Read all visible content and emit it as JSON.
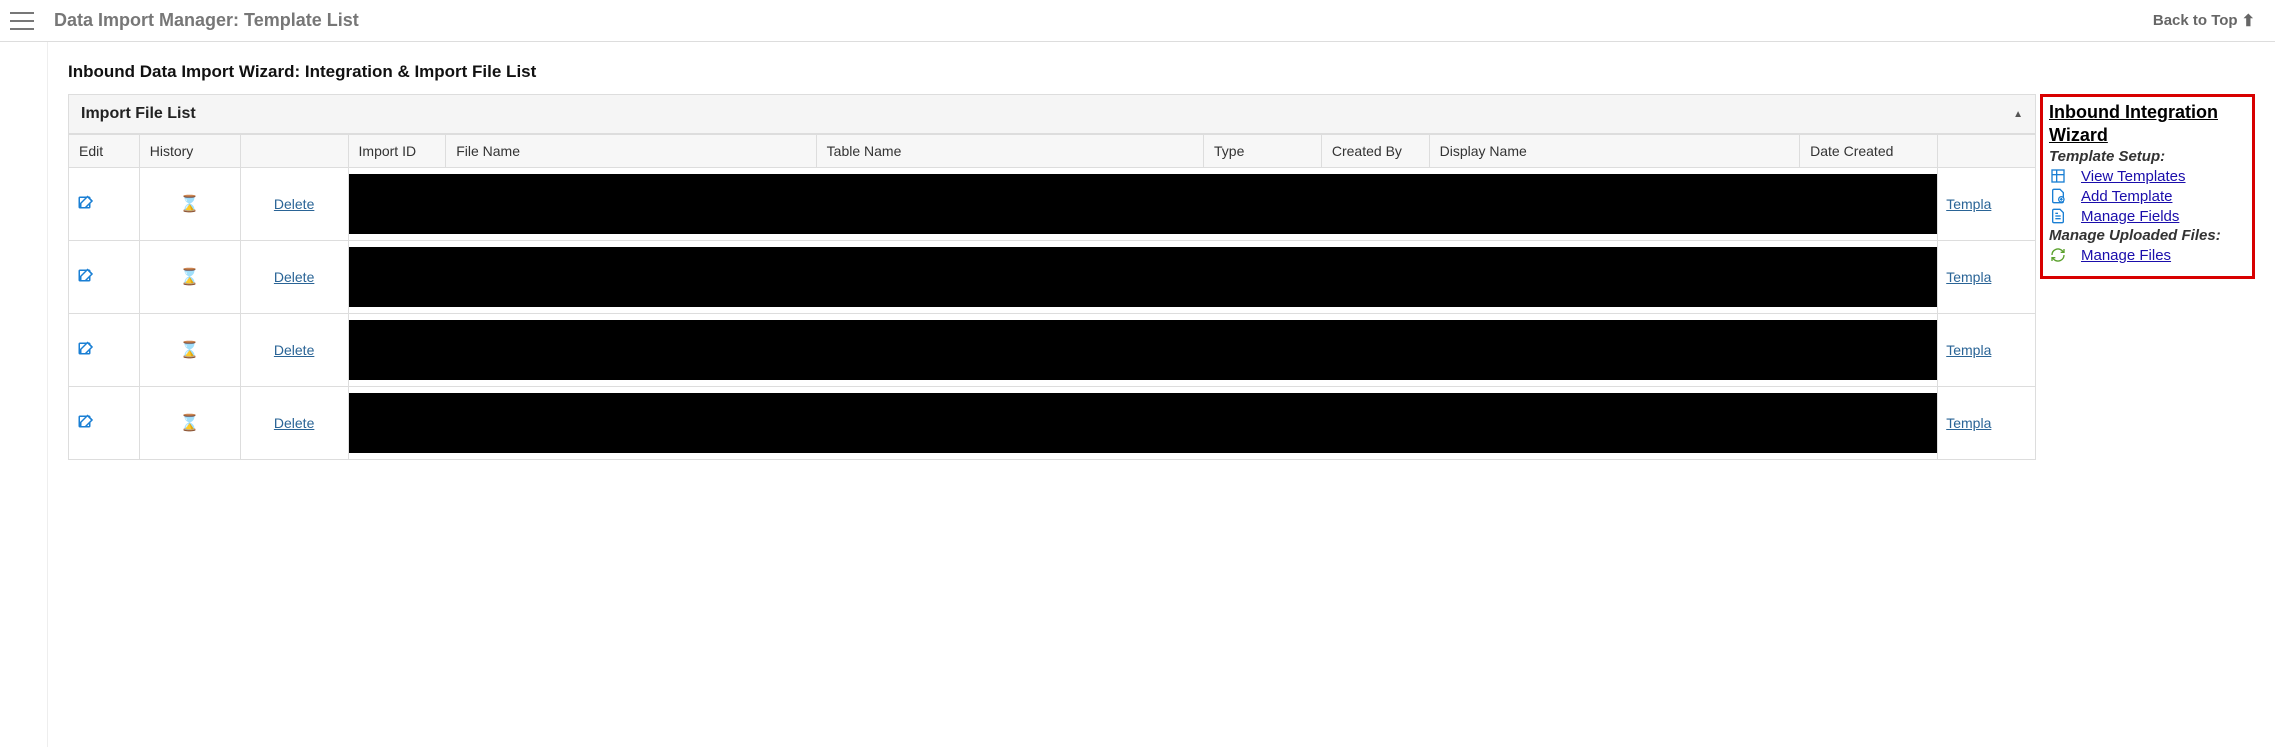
{
  "header": {
    "title": "Data Import Manager: Template List",
    "back_to_top": "Back to Top"
  },
  "section": {
    "heading": "Inbound Data Import Wizard: Integration & Import File List",
    "panel_title": "Import File List"
  },
  "columns": {
    "edit": "Edit",
    "history": "History",
    "delete_blank": "",
    "import_id": "Import ID",
    "file_name": "File Name",
    "table_name": "Table Name",
    "type": "Type",
    "created_by": "Created By",
    "display_name": "Display Name",
    "date_created": "Date Created",
    "action_blank": ""
  },
  "row_labels": {
    "delete": "Delete",
    "template": "Templa"
  },
  "rows": [
    {
      "id": 1
    },
    {
      "id": 2
    },
    {
      "id": 3
    },
    {
      "id": 4
    }
  ],
  "sidebar": {
    "title": "Inbound Integration Wizard",
    "template_setup": "Template Setup:",
    "links1": [
      {
        "icon": "table-icon",
        "label": "View Templates"
      },
      {
        "icon": "add-doc-icon",
        "label": "Add Template"
      },
      {
        "icon": "fields-icon",
        "label": "Manage Fields"
      }
    ],
    "manage_uploaded": "Manage Uploaded Files:",
    "links2": [
      {
        "icon": "refresh-icon",
        "label": "Manage Files"
      }
    ]
  }
}
